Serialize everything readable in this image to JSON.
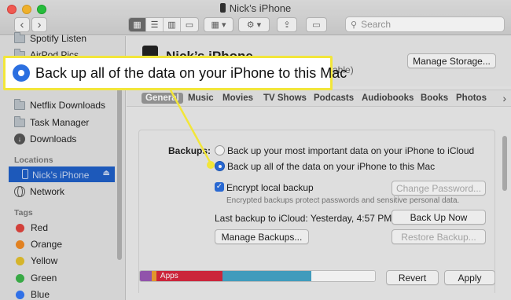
{
  "window": {
    "title": "Nick’s iPhone"
  },
  "toolbar": {
    "back": "‹",
    "forward": "›",
    "search_placeholder": "Search"
  },
  "sidebar": {
    "items": [
      {
        "label": "Spotify Listen"
      },
      {
        "label": "AirPod Pics"
      },
      {
        "label": "Netflix Downloads"
      },
      {
        "label": "Task Manager"
      },
      {
        "label": "Downloads"
      }
    ],
    "locations_heading": "Locations",
    "locations": [
      {
        "label": "Nick’s iPhone"
      },
      {
        "label": "Network"
      }
    ],
    "tags_heading": "Tags",
    "tags": [
      {
        "label": "Red",
        "color": "#e0443e"
      },
      {
        "label": "Orange",
        "color": "#f08a24"
      },
      {
        "label": "Yellow",
        "color": "#e3c02d"
      },
      {
        "label": "Green",
        "color": "#3cb44a"
      },
      {
        "label": "Blue",
        "color": "#3478f6"
      }
    ]
  },
  "device": {
    "name": "Nick’s iPhone",
    "subtitle_fragment": "able)",
    "manage_storage_label": "Manage Storage..."
  },
  "tabs": [
    "General",
    "Music",
    "Movies",
    "TV Shows",
    "Podcasts",
    "Audiobooks",
    "Books",
    "Photos"
  ],
  "tabs_more": "›",
  "backups": {
    "label": "Backups:",
    "option_icloud": "Back up your most important data on your iPhone to iCloud",
    "option_mac": "Back up all of the data on your iPhone to this Mac",
    "selected": "mac",
    "encrypt_label": "Encrypt local backup",
    "encrypt_checked": true,
    "encrypt_note": "Encrypted backups protect passwords and sensitive personal data.",
    "change_password_label": "Change Password...",
    "last_backup": "Last backup to iCloud:  Yesterday, 4:57 PM",
    "back_up_now_label": "Back Up Now",
    "manage_backups_label": "Manage Backups...",
    "restore_backup_label": "Restore Backup..."
  },
  "storage_bar": {
    "apps_label": "Apps",
    "segments": [
      {
        "name": "Purple",
        "fraction": 0.05,
        "color": "#9b59b6"
      },
      {
        "name": "Orange",
        "fraction": 0.02,
        "color": "#f0a030"
      },
      {
        "name": "Apps",
        "fraction": 0.28,
        "color": "#d8283e"
      },
      {
        "name": "Teal",
        "fraction": 0.38,
        "color": "#45a5c8"
      },
      {
        "name": "Free",
        "fraction": 0.27,
        "color": "#ffffff"
      }
    ]
  },
  "footer": {
    "revert_label": "Revert",
    "apply_label": "Apply"
  },
  "callout": {
    "text": "Back up all of the data on your iPhone to this Mac",
    "border_color": "#f2e63a"
  }
}
